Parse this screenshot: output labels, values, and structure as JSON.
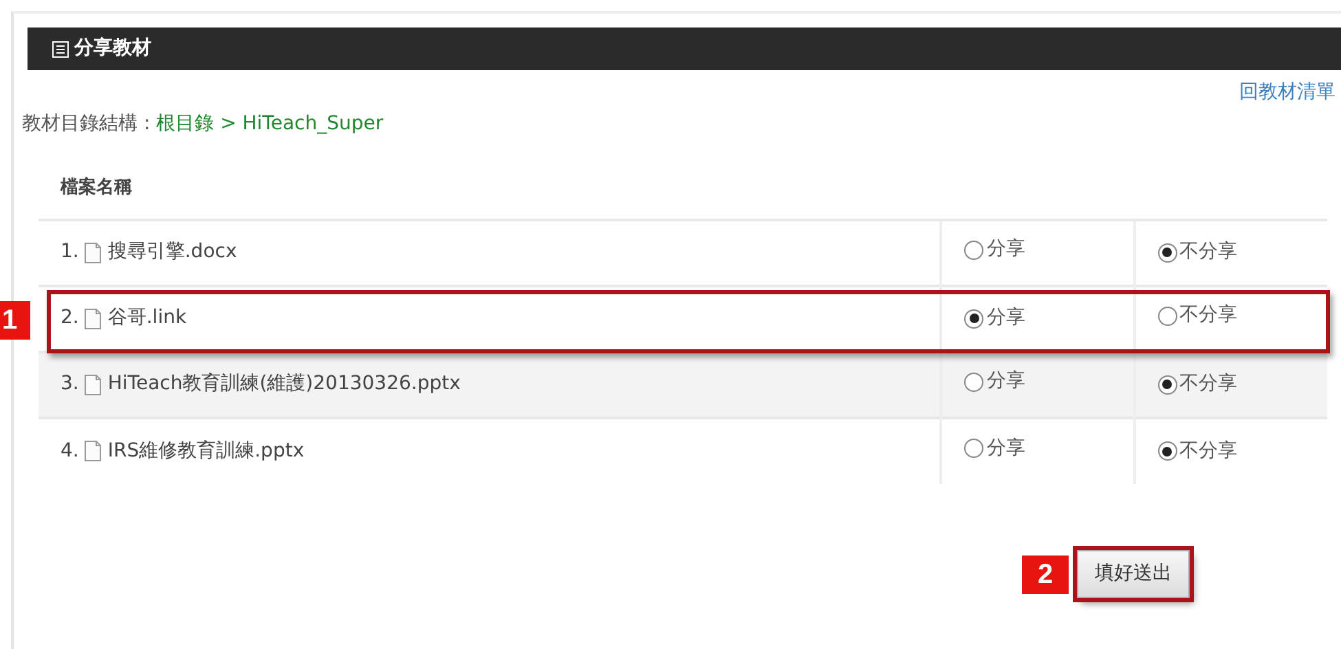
{
  "panel": {
    "title": "分享教材"
  },
  "back_link": "回教材清單",
  "breadcrumb": {
    "label": "教材目錄結構 : ",
    "path": [
      {
        "text": "根目錄"
      },
      {
        "text": "HiTeach_Super"
      }
    ],
    "separator": " > "
  },
  "table": {
    "columns": [
      "檔案名稱"
    ],
    "rows": [
      {
        "index": "1.",
        "name": "搜尋引擎.docx",
        "highlighted": false,
        "options": [
          {
            "label": "分享",
            "selected": false
          },
          {
            "label": "不分享",
            "selected": true
          }
        ]
      },
      {
        "index": "2.",
        "name": "谷哥.link",
        "highlighted": true,
        "callout": "1",
        "options": [
          {
            "label": "分享",
            "selected": true
          },
          {
            "label": "不分享",
            "selected": false
          }
        ]
      },
      {
        "index": "3.",
        "name": "HiTeach教育訓練(維護)20130326.pptx",
        "highlighted": false,
        "options": [
          {
            "label": "分享",
            "selected": false
          },
          {
            "label": "不分享",
            "selected": true
          }
        ]
      },
      {
        "index": "4.",
        "name": "IRS維修教育訓練.pptx",
        "highlighted": false,
        "options": [
          {
            "label": "分享",
            "selected": false
          },
          {
            "label": "不分享",
            "selected": true
          }
        ]
      }
    ]
  },
  "submit": {
    "label": "填好送出",
    "highlighted": true,
    "callout": "2"
  }
}
